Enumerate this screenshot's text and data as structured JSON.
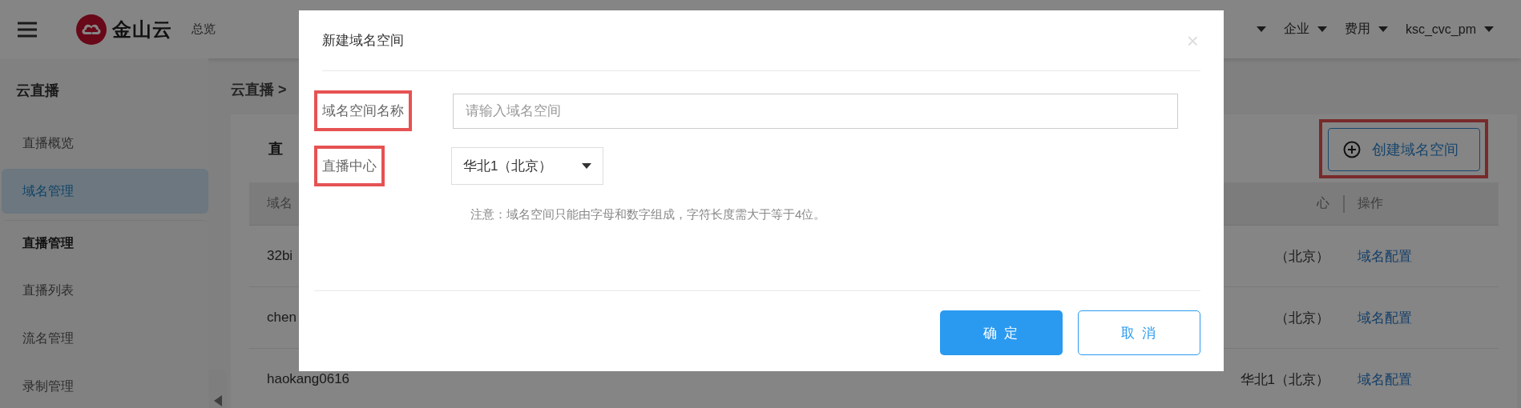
{
  "header": {
    "logo_text": "金山云",
    "overview": "总览",
    "nav": [
      {
        "kind": "caret_only"
      },
      {
        "kind": "menu",
        "label": "企业"
      },
      {
        "kind": "menu",
        "label": "费用"
      },
      {
        "kind": "menu",
        "label": "ksc_cvc_pm"
      }
    ]
  },
  "sidebar": {
    "title": "云直播",
    "items": [
      {
        "label": "直播概览",
        "kind": "item",
        "selected": false
      },
      {
        "label": "域名管理",
        "kind": "item",
        "selected": true
      },
      {
        "label": "直播管理",
        "kind": "section"
      },
      {
        "label": "直播列表",
        "kind": "item",
        "selected": false
      },
      {
        "label": "流名管理",
        "kind": "item",
        "selected": false
      },
      {
        "label": "录制管理",
        "kind": "item",
        "selected": false
      }
    ]
  },
  "breadcrumb": "云直播 >",
  "card": {
    "title": "直",
    "create_button": "创建域名空间",
    "table": {
      "columns": [
        "域名",
        "心",
        "操作"
      ],
      "rows": [
        {
          "name": "32bi",
          "region": "（北京）",
          "action": "域名配置"
        },
        {
          "name": "chen",
          "region": "（北京）",
          "action": "域名配置"
        },
        {
          "name": "haokang0616",
          "region": "华北1（北京）",
          "action": "域名配置"
        }
      ]
    }
  },
  "dialog": {
    "title": "新建域名空间",
    "close": "×",
    "name_field": {
      "label": "域名空间名称",
      "placeholder": "请输入域名空间"
    },
    "center_field": {
      "label": "直播中心",
      "value": "华北1（北京）"
    },
    "note": "注意：域名空间只能由字母和数字组成，字符长度需大于等于4位。",
    "buttons": [
      {
        "label": "确 定",
        "kind": "primary"
      },
      {
        "label": "取 消",
        "kind": "secondary"
      }
    ]
  }
}
